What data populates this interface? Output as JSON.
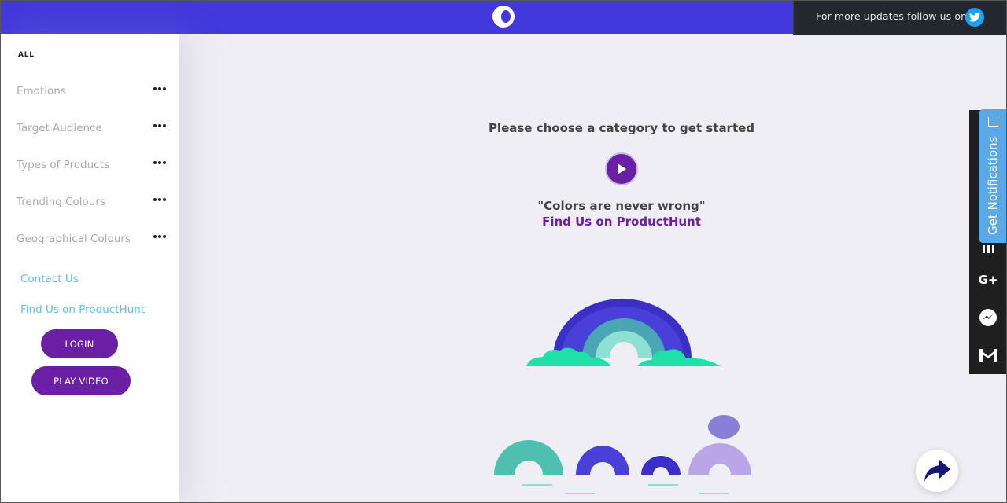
{
  "header": {
    "follow_text": "For more updates follow us on",
    "logo_icon": "moon-logo-icon",
    "twitter_icon": "twitter-icon",
    "bar_color": "#4338db"
  },
  "sidebar": {
    "all_label": "ALL",
    "items": [
      {
        "label": "Emotions"
      },
      {
        "label": "Target Audience"
      },
      {
        "label": "Types of Products"
      },
      {
        "label": "Trending Colours"
      },
      {
        "label": "Geographical Colours"
      }
    ],
    "contact_link": "Contact Us",
    "producthunt_link": "Find Us on ProductHunt",
    "login_button": "LOGIN",
    "play_video_button": "PLAY VIDEO"
  },
  "main": {
    "heading": "Please choose a category to get started",
    "quote": "\"Colors are never wrong\"",
    "producthunt_link": "Find Us on ProductHunt"
  },
  "notifications": {
    "label": "Get Notifications"
  },
  "social": {
    "icons": [
      "linkedin-icon",
      "google-plus-icon",
      "messenger-icon",
      "gmail-icon"
    ],
    "google_plus_label": "G+"
  },
  "accent_color": "#6b1fa5"
}
